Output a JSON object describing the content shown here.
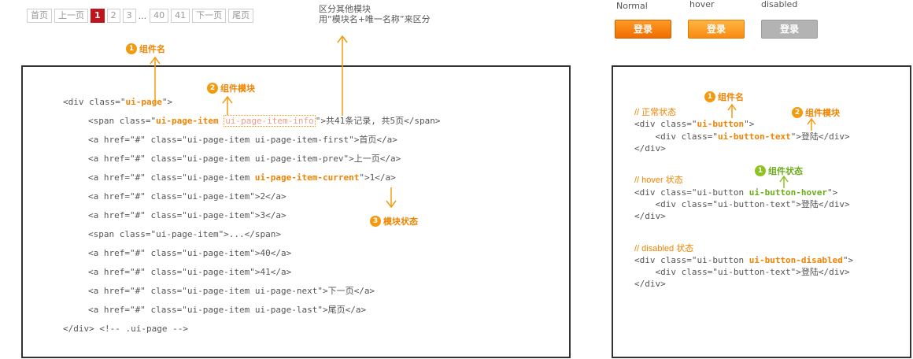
{
  "pager": {
    "items": [
      "首页",
      "上一页",
      "1",
      "2",
      "3",
      "...",
      "40",
      "41",
      "下一页",
      "尾页"
    ],
    "current": "1"
  },
  "top_note": {
    "line1": "区分其他模块",
    "line2": "用“模块名+唯一名称”来区分"
  },
  "left_labels": {
    "label1": {
      "num": "1",
      "text": "组件名"
    },
    "label2": {
      "num": "2",
      "text": "组件模块"
    },
    "label3": {
      "num": "3",
      "text": "模块状态"
    }
  },
  "left_code": {
    "l1_pre": "<div class=\"",
    "l1_hl": "ui-page",
    "l1_post": "\">",
    "l2_pre": "<span class=\"",
    "l2_hl": "ui-page-item",
    "l2_box": "ui-page-item-info",
    "l2_post": "\">共41条记录, 共5页</span>",
    "l3": "<a href=\"#\" class=\"ui-page-item ui-page-item-first\">首页</a>",
    "l4": "<a href=\"#\" class=\"ui-page-item ui-page-item-prev\">上一页</a>",
    "l5_pre": "<a href=\"#\" class=\"ui-page-item ",
    "l5_hl": "ui-page-item-current",
    "l5_post": "\">1</a>",
    "l6": "<a href=\"#\" class=\"ui-page-item\">2</a>",
    "l7": "<a href=\"#\" class=\"ui-page-item\">3</a>",
    "l8": "<span class=\"ui-page-item\">...</span>",
    "l9": "<a href=\"#\" class=\"ui-page-item\">40</a>",
    "l10": "<a href=\"#\" class=\"ui-page-item\">41</a>",
    "l11": "<a href=\"#\" class=\"ui-page-item ui-page-next\">下一页</a>",
    "l12": "<a href=\"#\" class=\"ui-page-item ui-page-last\">尾页</a>",
    "l13": "</div> <!-- .ui-page -->"
  },
  "buttons": {
    "states": [
      "Normal",
      "hover",
      "disabled"
    ],
    "label": "登录"
  },
  "right_labels": {
    "label1": {
      "num": "1",
      "text": "组件名"
    },
    "label2": {
      "num": "2",
      "text": "组件模块"
    },
    "label3": {
      "num": "1",
      "text": "组件状态"
    }
  },
  "right_code": {
    "c1": "// 正常状态",
    "r1_pre": "<div class=\"",
    "r1_hl": "ui-button",
    "r1_post": "\">",
    "r2_pre": "    <div class=\"",
    "r2_hl": "ui-button-text",
    "r2_post": "\">登陆</div>",
    "r3": "</div>",
    "c2": "// hover 状态",
    "r4_pre": "<div class=\"ui-button ",
    "r4_hl": "ui-button-hover",
    "r4_post": "\">",
    "r5": "    <div class=\"ui-button-text\">登陆</div>",
    "r6": "</div>",
    "c3": "// disabled 状态",
    "r7_pre": "<div class=\"ui-button ",
    "r7_hl": "ui-button-disabled",
    "r7_post": "\">",
    "r8": "    <div class=\"ui-button-text\">登陆</div>",
    "r9": "</div>"
  },
  "colors": {
    "accent_orange": "#f08300",
    "accent_green": "#8ec21f",
    "pager_current": "#c0161b",
    "button_disabled": "#b3b3b3"
  }
}
